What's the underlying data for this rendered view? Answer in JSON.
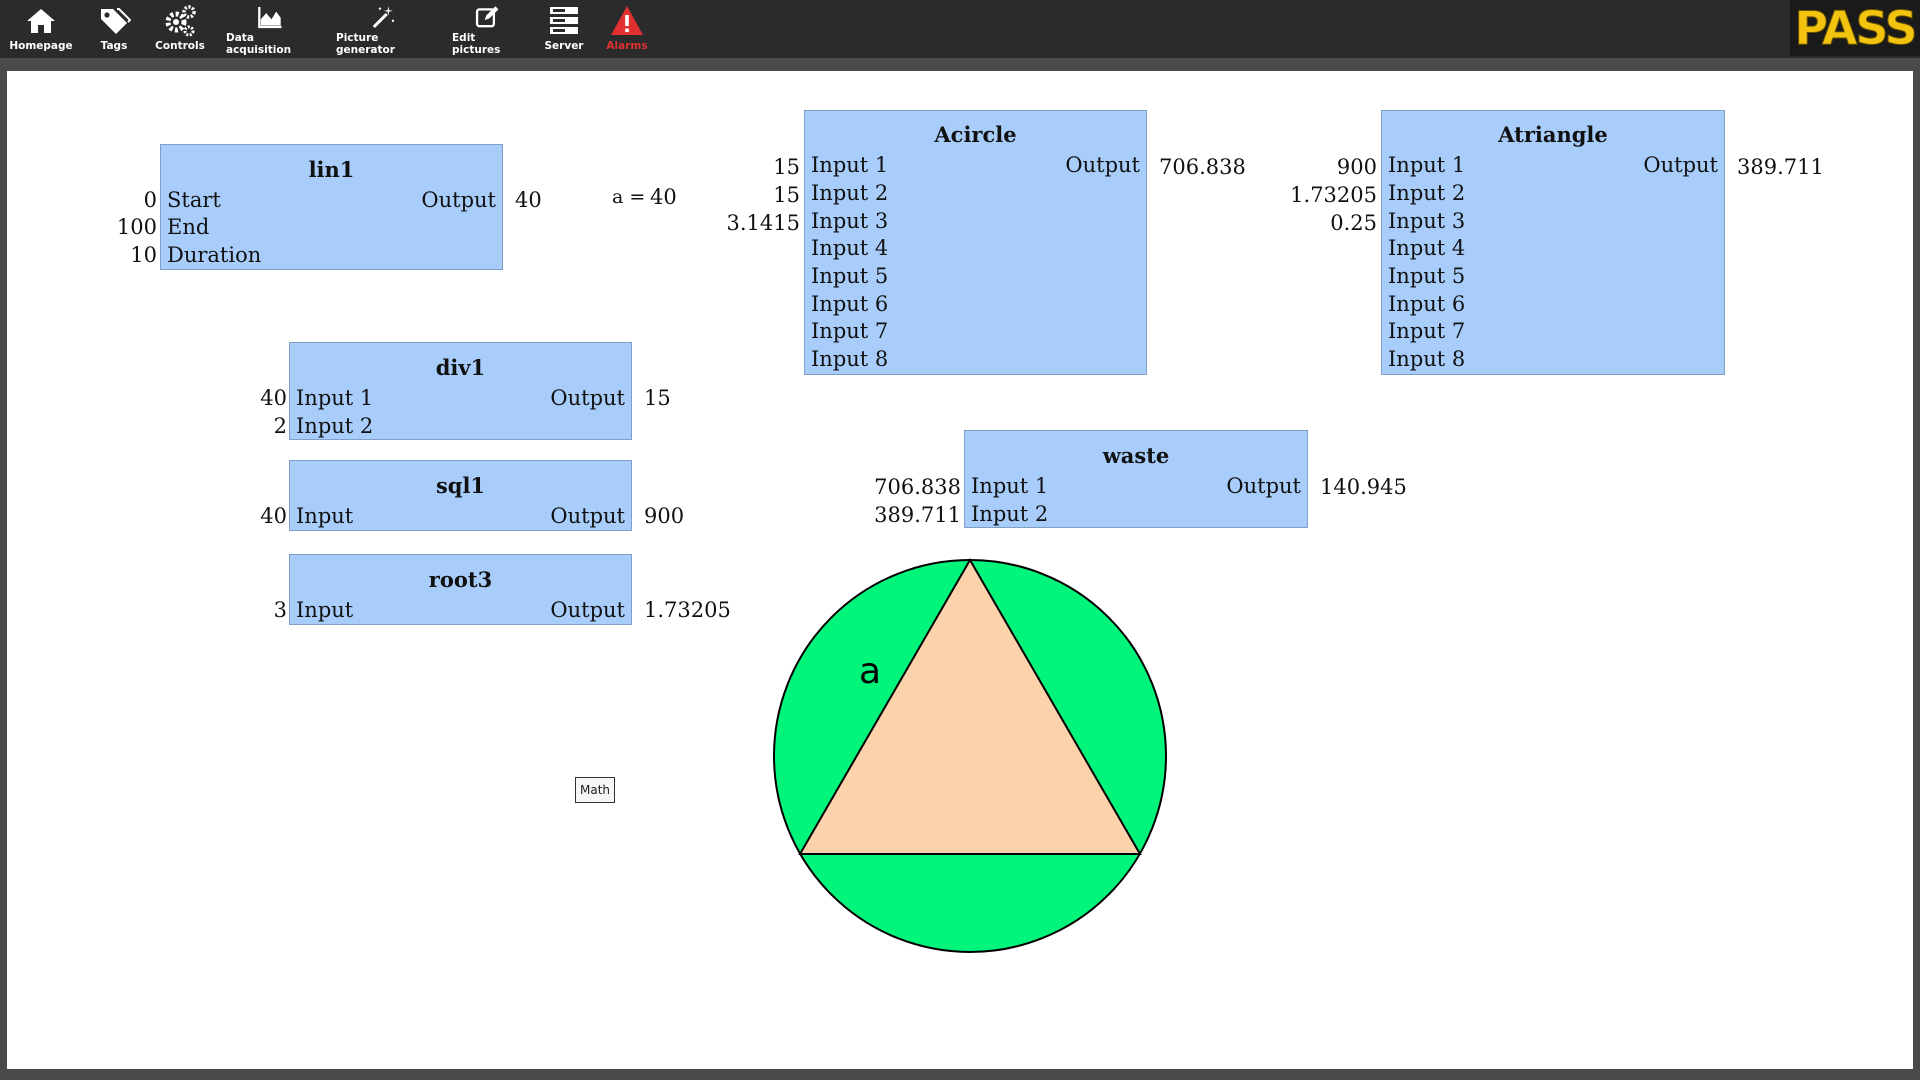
{
  "toolbar": {
    "items": [
      {
        "label": "Homepage",
        "icon": "home-icon"
      },
      {
        "label": "Tags",
        "icon": "tags-icon"
      },
      {
        "label": "Controls",
        "icon": "gears-icon"
      },
      {
        "label": "Data acquisition",
        "icon": "area-chart-icon"
      },
      {
        "label": "Picture generator",
        "icon": "magic-wand-icon"
      },
      {
        "label": "Edit pictures",
        "icon": "edit-icon"
      },
      {
        "label": "Server",
        "icon": "server-icon"
      },
      {
        "label": "Alarms",
        "icon": "warning-icon",
        "color": "#e03030"
      }
    ],
    "logo": "PASS",
    "logo_color": "#f2c30f"
  },
  "blocks": {
    "lin1": {
      "title": "lin1",
      "inputs": [
        "Start",
        "End",
        "Duration"
      ],
      "input_values": [
        "0",
        "100",
        "10"
      ],
      "output_label": "Output",
      "output_value": "40"
    },
    "div1": {
      "title": "div1",
      "inputs": [
        "Input 1",
        "Input 2"
      ],
      "input_values": [
        "40",
        "2"
      ],
      "output_label": "Output",
      "output_value": "15"
    },
    "sql": {
      "title": "sql1",
      "inputs": [
        "Input"
      ],
      "input_values": [
        "40"
      ],
      "output_label": "Output",
      "output_value": "900"
    },
    "root3": {
      "title": "root3",
      "inputs": [
        "Input"
      ],
      "input_values": [
        "3"
      ],
      "output_label": "Output",
      "output_value": "1.73205"
    },
    "acircle": {
      "title": "Acircle",
      "inputs": [
        "Input 1",
        "Input 2",
        "Input 3",
        "Input 4",
        "Input 5",
        "Input 6",
        "Input 7",
        "Input 8"
      ],
      "input_values": [
        "15",
        "15",
        "3.1415"
      ],
      "output_label": "Output",
      "output_value": "706.838"
    },
    "atriangle": {
      "title": "Atriangle",
      "inputs": [
        "Input 1",
        "Input 2",
        "Input 3",
        "Input 4",
        "Input 5",
        "Input 6",
        "Input 7",
        "Input 8"
      ],
      "input_values": [
        "900",
        "1.73205",
        "0.25"
      ],
      "output_label": "Output",
      "output_value": "389.711"
    },
    "waste": {
      "title": "waste",
      "inputs": [
        "Input 1",
        "Input 2"
      ],
      "input_values": [
        "706.838",
        "389.711"
      ],
      "output_label": "Output",
      "output_value": "140.945"
    }
  },
  "variable": {
    "label": "a =",
    "value": "40"
  },
  "math_button": "Math",
  "shape": {
    "side_label": "a",
    "circle_color": "#00f57a",
    "triangle_color": "#fcd2aa",
    "block_color": "#a8cdfb"
  }
}
